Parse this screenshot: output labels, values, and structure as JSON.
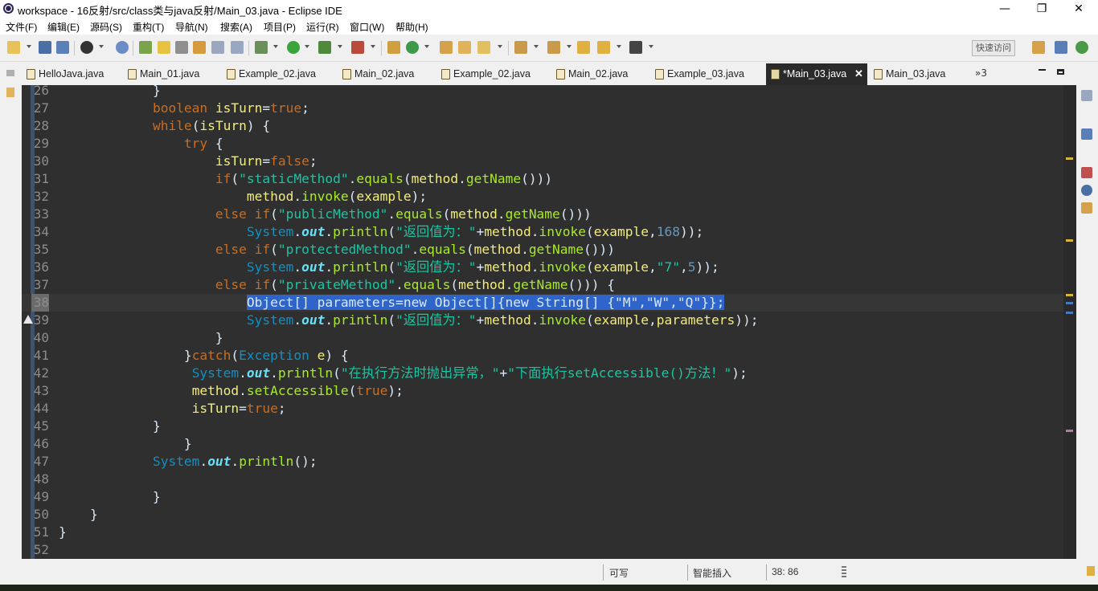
{
  "window": {
    "title": "workspace - 16反射/src/class类与java反射/Main_03.java - Eclipse IDE",
    "minimize_glyph": "—",
    "restore_glyph": "❐",
    "close_glyph": "✕"
  },
  "menu": {
    "items": [
      "文件(F)",
      "编辑(E)",
      "源码(S)",
      "重构(T)",
      "导航(N)",
      "搜索(A)",
      "项目(P)",
      "运行(R)",
      "窗口(W)",
      "帮助(H)"
    ]
  },
  "toolbar": {
    "quick_access_placeholder": "快速访问"
  },
  "tabs": {
    "items": [
      {
        "label": "HelloJava.java"
      },
      {
        "label": "Main_01.java"
      },
      {
        "label": "Example_02.java"
      },
      {
        "label": "Main_02.java"
      },
      {
        "label": "Example_02.java"
      },
      {
        "label": "Main_02.java"
      },
      {
        "label": "Example_03.java"
      },
      {
        "label": "*Main_03.java",
        "active": true
      },
      {
        "label": "Main_03.java"
      }
    ],
    "close_glyph": "✕",
    "overflow_label": "»3"
  },
  "editor": {
    "current_line": 38,
    "warning_line": 39,
    "lines": [
      {
        "n": 26,
        "t": [
          [
            "plain",
            "            }"
          ]
        ]
      },
      {
        "n": 27,
        "t": [
          [
            "plain",
            "            "
          ],
          [
            "kw",
            "boolean"
          ],
          [
            "plain",
            " "
          ],
          [
            "var",
            "isTurn"
          ],
          [
            "plain",
            "="
          ],
          [
            "kw",
            "true"
          ],
          [
            "plain",
            ";"
          ]
        ]
      },
      {
        "n": 28,
        "t": [
          [
            "plain",
            "            "
          ],
          [
            "kw",
            "while"
          ],
          [
            "plain",
            "("
          ],
          [
            "var",
            "isTurn"
          ],
          [
            "plain",
            ") {"
          ]
        ]
      },
      {
        "n": 29,
        "t": [
          [
            "plain",
            "                "
          ],
          [
            "kw",
            "try"
          ],
          [
            "plain",
            " {"
          ]
        ]
      },
      {
        "n": 30,
        "t": [
          [
            "plain",
            "                    "
          ],
          [
            "var",
            "isTurn"
          ],
          [
            "plain",
            "="
          ],
          [
            "kw",
            "false"
          ],
          [
            "plain",
            ";"
          ]
        ]
      },
      {
        "n": 31,
        "t": [
          [
            "plain",
            "                    "
          ],
          [
            "kw",
            "if"
          ],
          [
            "plain",
            "("
          ],
          [
            "str",
            "\"staticMethod\""
          ],
          [
            "plain",
            "."
          ],
          [
            "mtd",
            "equals"
          ],
          [
            "plain",
            "("
          ],
          [
            "var",
            "method"
          ],
          [
            "plain",
            "."
          ],
          [
            "mtd",
            "getName"
          ],
          [
            "plain",
            "()))"
          ]
        ]
      },
      {
        "n": 32,
        "t": [
          [
            "plain",
            "                        "
          ],
          [
            "var",
            "method"
          ],
          [
            "plain",
            "."
          ],
          [
            "mtd",
            "invoke"
          ],
          [
            "plain",
            "("
          ],
          [
            "var",
            "example"
          ],
          [
            "plain",
            ");"
          ]
        ]
      },
      {
        "n": 33,
        "t": [
          [
            "plain",
            "                    "
          ],
          [
            "kw",
            "else"
          ],
          [
            "plain",
            " "
          ],
          [
            "kw",
            "if"
          ],
          [
            "plain",
            "("
          ],
          [
            "str",
            "\"publicMethod\""
          ],
          [
            "plain",
            "."
          ],
          [
            "mtd",
            "equals"
          ],
          [
            "plain",
            "("
          ],
          [
            "var",
            "method"
          ],
          [
            "plain",
            "."
          ],
          [
            "mtd",
            "getName"
          ],
          [
            "plain",
            "()))"
          ]
        ]
      },
      {
        "n": 34,
        "t": [
          [
            "plain",
            "                        "
          ],
          [
            "typ",
            "System"
          ],
          [
            "plain",
            "."
          ],
          [
            "fld",
            "out"
          ],
          [
            "plain",
            "."
          ],
          [
            "mtd",
            "println"
          ],
          [
            "plain",
            "("
          ],
          [
            "str",
            "\"返回值为：\""
          ],
          [
            "plain",
            "+"
          ],
          [
            "var",
            "method"
          ],
          [
            "plain",
            "."
          ],
          [
            "mtd",
            "invoke"
          ],
          [
            "plain",
            "("
          ],
          [
            "var",
            "example"
          ],
          [
            "plain",
            ","
          ],
          [
            "num",
            "168"
          ],
          [
            "plain",
            "));"
          ]
        ]
      },
      {
        "n": 35,
        "t": [
          [
            "plain",
            "                    "
          ],
          [
            "kw",
            "else"
          ],
          [
            "plain",
            " "
          ],
          [
            "kw",
            "if"
          ],
          [
            "plain",
            "("
          ],
          [
            "str",
            "\"protectedMethod\""
          ],
          [
            "plain",
            "."
          ],
          [
            "mtd",
            "equals"
          ],
          [
            "plain",
            "("
          ],
          [
            "var",
            "method"
          ],
          [
            "plain",
            "."
          ],
          [
            "mtd",
            "getName"
          ],
          [
            "plain",
            "()))"
          ]
        ]
      },
      {
        "n": 36,
        "t": [
          [
            "plain",
            "                        "
          ],
          [
            "typ",
            "System"
          ],
          [
            "plain",
            "."
          ],
          [
            "fld",
            "out"
          ],
          [
            "plain",
            "."
          ],
          [
            "mtd",
            "println"
          ],
          [
            "plain",
            "("
          ],
          [
            "str",
            "\"返回值为：\""
          ],
          [
            "plain",
            "+"
          ],
          [
            "var",
            "method"
          ],
          [
            "plain",
            "."
          ],
          [
            "mtd",
            "invoke"
          ],
          [
            "plain",
            "("
          ],
          [
            "var",
            "example"
          ],
          [
            "plain",
            ","
          ],
          [
            "str",
            "\"7\""
          ],
          [
            "plain",
            ","
          ],
          [
            "num",
            "5"
          ],
          [
            "plain",
            "));"
          ]
        ]
      },
      {
        "n": 37,
        "t": [
          [
            "plain",
            "                    "
          ],
          [
            "kw",
            "else"
          ],
          [
            "plain",
            " "
          ],
          [
            "kw",
            "if"
          ],
          [
            "plain",
            "("
          ],
          [
            "str",
            "\"privateMethod\""
          ],
          [
            "plain",
            "."
          ],
          [
            "mtd",
            "equals"
          ],
          [
            "plain",
            "("
          ],
          [
            "var",
            "method"
          ],
          [
            "plain",
            "."
          ],
          [
            "mtd",
            "getName"
          ],
          [
            "plain",
            "())) {"
          ]
        ]
      },
      {
        "n": 38,
        "t": [
          [
            "plain",
            "                        "
          ],
          [
            "sel",
            "Object[] parameters=new Object[]{new String[] {\"M\",\"W\",\"Q\"}};"
          ]
        ]
      },
      {
        "n": 39,
        "t": [
          [
            "plain",
            "                        "
          ],
          [
            "typ",
            "System"
          ],
          [
            "plain",
            "."
          ],
          [
            "fld",
            "out"
          ],
          [
            "plain",
            "."
          ],
          [
            "mtd",
            "println"
          ],
          [
            "plain",
            "("
          ],
          [
            "str",
            "\"返回值为：\""
          ],
          [
            "plain",
            "+"
          ],
          [
            "var",
            "method"
          ],
          [
            "plain",
            "."
          ],
          [
            "mtd",
            "invoke"
          ],
          [
            "plain",
            "("
          ],
          [
            "var",
            "example"
          ],
          [
            "plain",
            ","
          ],
          [
            "var",
            "parameters"
          ],
          [
            "plain",
            "));"
          ]
        ]
      },
      {
        "n": 40,
        "t": [
          [
            "plain",
            "                    }"
          ]
        ]
      },
      {
        "n": 41,
        "t": [
          [
            "plain",
            "                }"
          ],
          [
            "kw",
            "catch"
          ],
          [
            "plain",
            "("
          ],
          [
            "typ",
            "Exception"
          ],
          [
            "plain",
            " "
          ],
          [
            "var",
            "e"
          ],
          [
            "plain",
            ") {"
          ]
        ]
      },
      {
        "n": 42,
        "t": [
          [
            "plain",
            "                 "
          ],
          [
            "typ",
            "System"
          ],
          [
            "plain",
            "."
          ],
          [
            "fld",
            "out"
          ],
          [
            "plain",
            "."
          ],
          [
            "mtd",
            "println"
          ],
          [
            "plain",
            "("
          ],
          [
            "str",
            "\"在执行方法时抛出异常，\""
          ],
          [
            "plain",
            "+"
          ],
          [
            "str",
            "\"下面执行setAccessible()方法！\""
          ],
          [
            "plain",
            ");"
          ]
        ]
      },
      {
        "n": 43,
        "t": [
          [
            "plain",
            "                 "
          ],
          [
            "var",
            "method"
          ],
          [
            "plain",
            "."
          ],
          [
            "mtd",
            "setAccessible"
          ],
          [
            "plain",
            "("
          ],
          [
            "kw",
            "true"
          ],
          [
            "plain",
            ");"
          ]
        ]
      },
      {
        "n": 44,
        "t": [
          [
            "plain",
            "                 "
          ],
          [
            "var",
            "isTurn"
          ],
          [
            "plain",
            "="
          ],
          [
            "kw",
            "true"
          ],
          [
            "plain",
            ";"
          ]
        ]
      },
      {
        "n": 45,
        "t": [
          [
            "plain",
            "            }"
          ]
        ]
      },
      {
        "n": 46,
        "t": [
          [
            "plain",
            "                }"
          ]
        ]
      },
      {
        "n": 47,
        "t": [
          [
            "plain",
            "            "
          ],
          [
            "typ",
            "System"
          ],
          [
            "plain",
            "."
          ],
          [
            "fld",
            "out"
          ],
          [
            "plain",
            "."
          ],
          [
            "mtd",
            "println"
          ],
          [
            "plain",
            "();"
          ]
        ]
      },
      {
        "n": 48,
        "t": [
          [
            "plain",
            ""
          ]
        ]
      },
      {
        "n": 49,
        "t": [
          [
            "plain",
            "            }"
          ]
        ]
      },
      {
        "n": 50,
        "t": [
          [
            "plain",
            "    }"
          ]
        ]
      },
      {
        "n": 51,
        "t": [
          [
            "plain",
            "}"
          ]
        ]
      },
      {
        "n": 52,
        "t": [
          [
            "plain",
            ""
          ]
        ]
      }
    ]
  },
  "status": {
    "writable": "可写",
    "insert_mode": "智能插入",
    "position": "38: 86"
  },
  "colors": {
    "editor_bg": "#2f2f2f",
    "selection": "#2f65ca",
    "keyword": "#cc6c1d",
    "string": "#17c6a3",
    "method": "#a7ec21",
    "variable": "#f3ec79"
  }
}
